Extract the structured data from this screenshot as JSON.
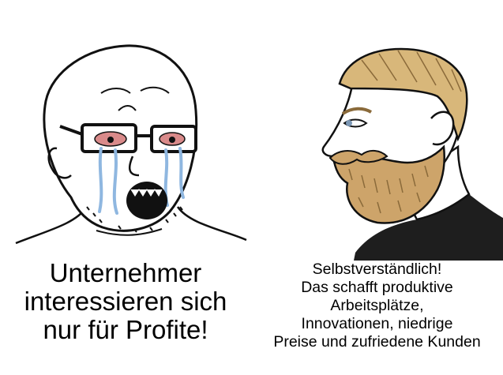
{
  "left_panel": {
    "caption_lines": [
      "Unternehmer",
      "interessieren sich",
      "nur für Profite!"
    ]
  },
  "right_panel": {
    "caption_lines": [
      "Selbstverständlich!",
      "Das schafft produktive",
      "Arbeitsplätze,",
      "Innovationen, niedrige",
      "Preise und zufriedene Kunden"
    ]
  },
  "colors": {
    "background": "#ffffff",
    "line": "#111111",
    "tears": "#8fb7e0",
    "eye_red": "#d98a8a",
    "hair": "#d8b77a",
    "beard": "#cda46a",
    "shirt": "#1e1e1e",
    "eye_blue": "#7b97b5"
  }
}
